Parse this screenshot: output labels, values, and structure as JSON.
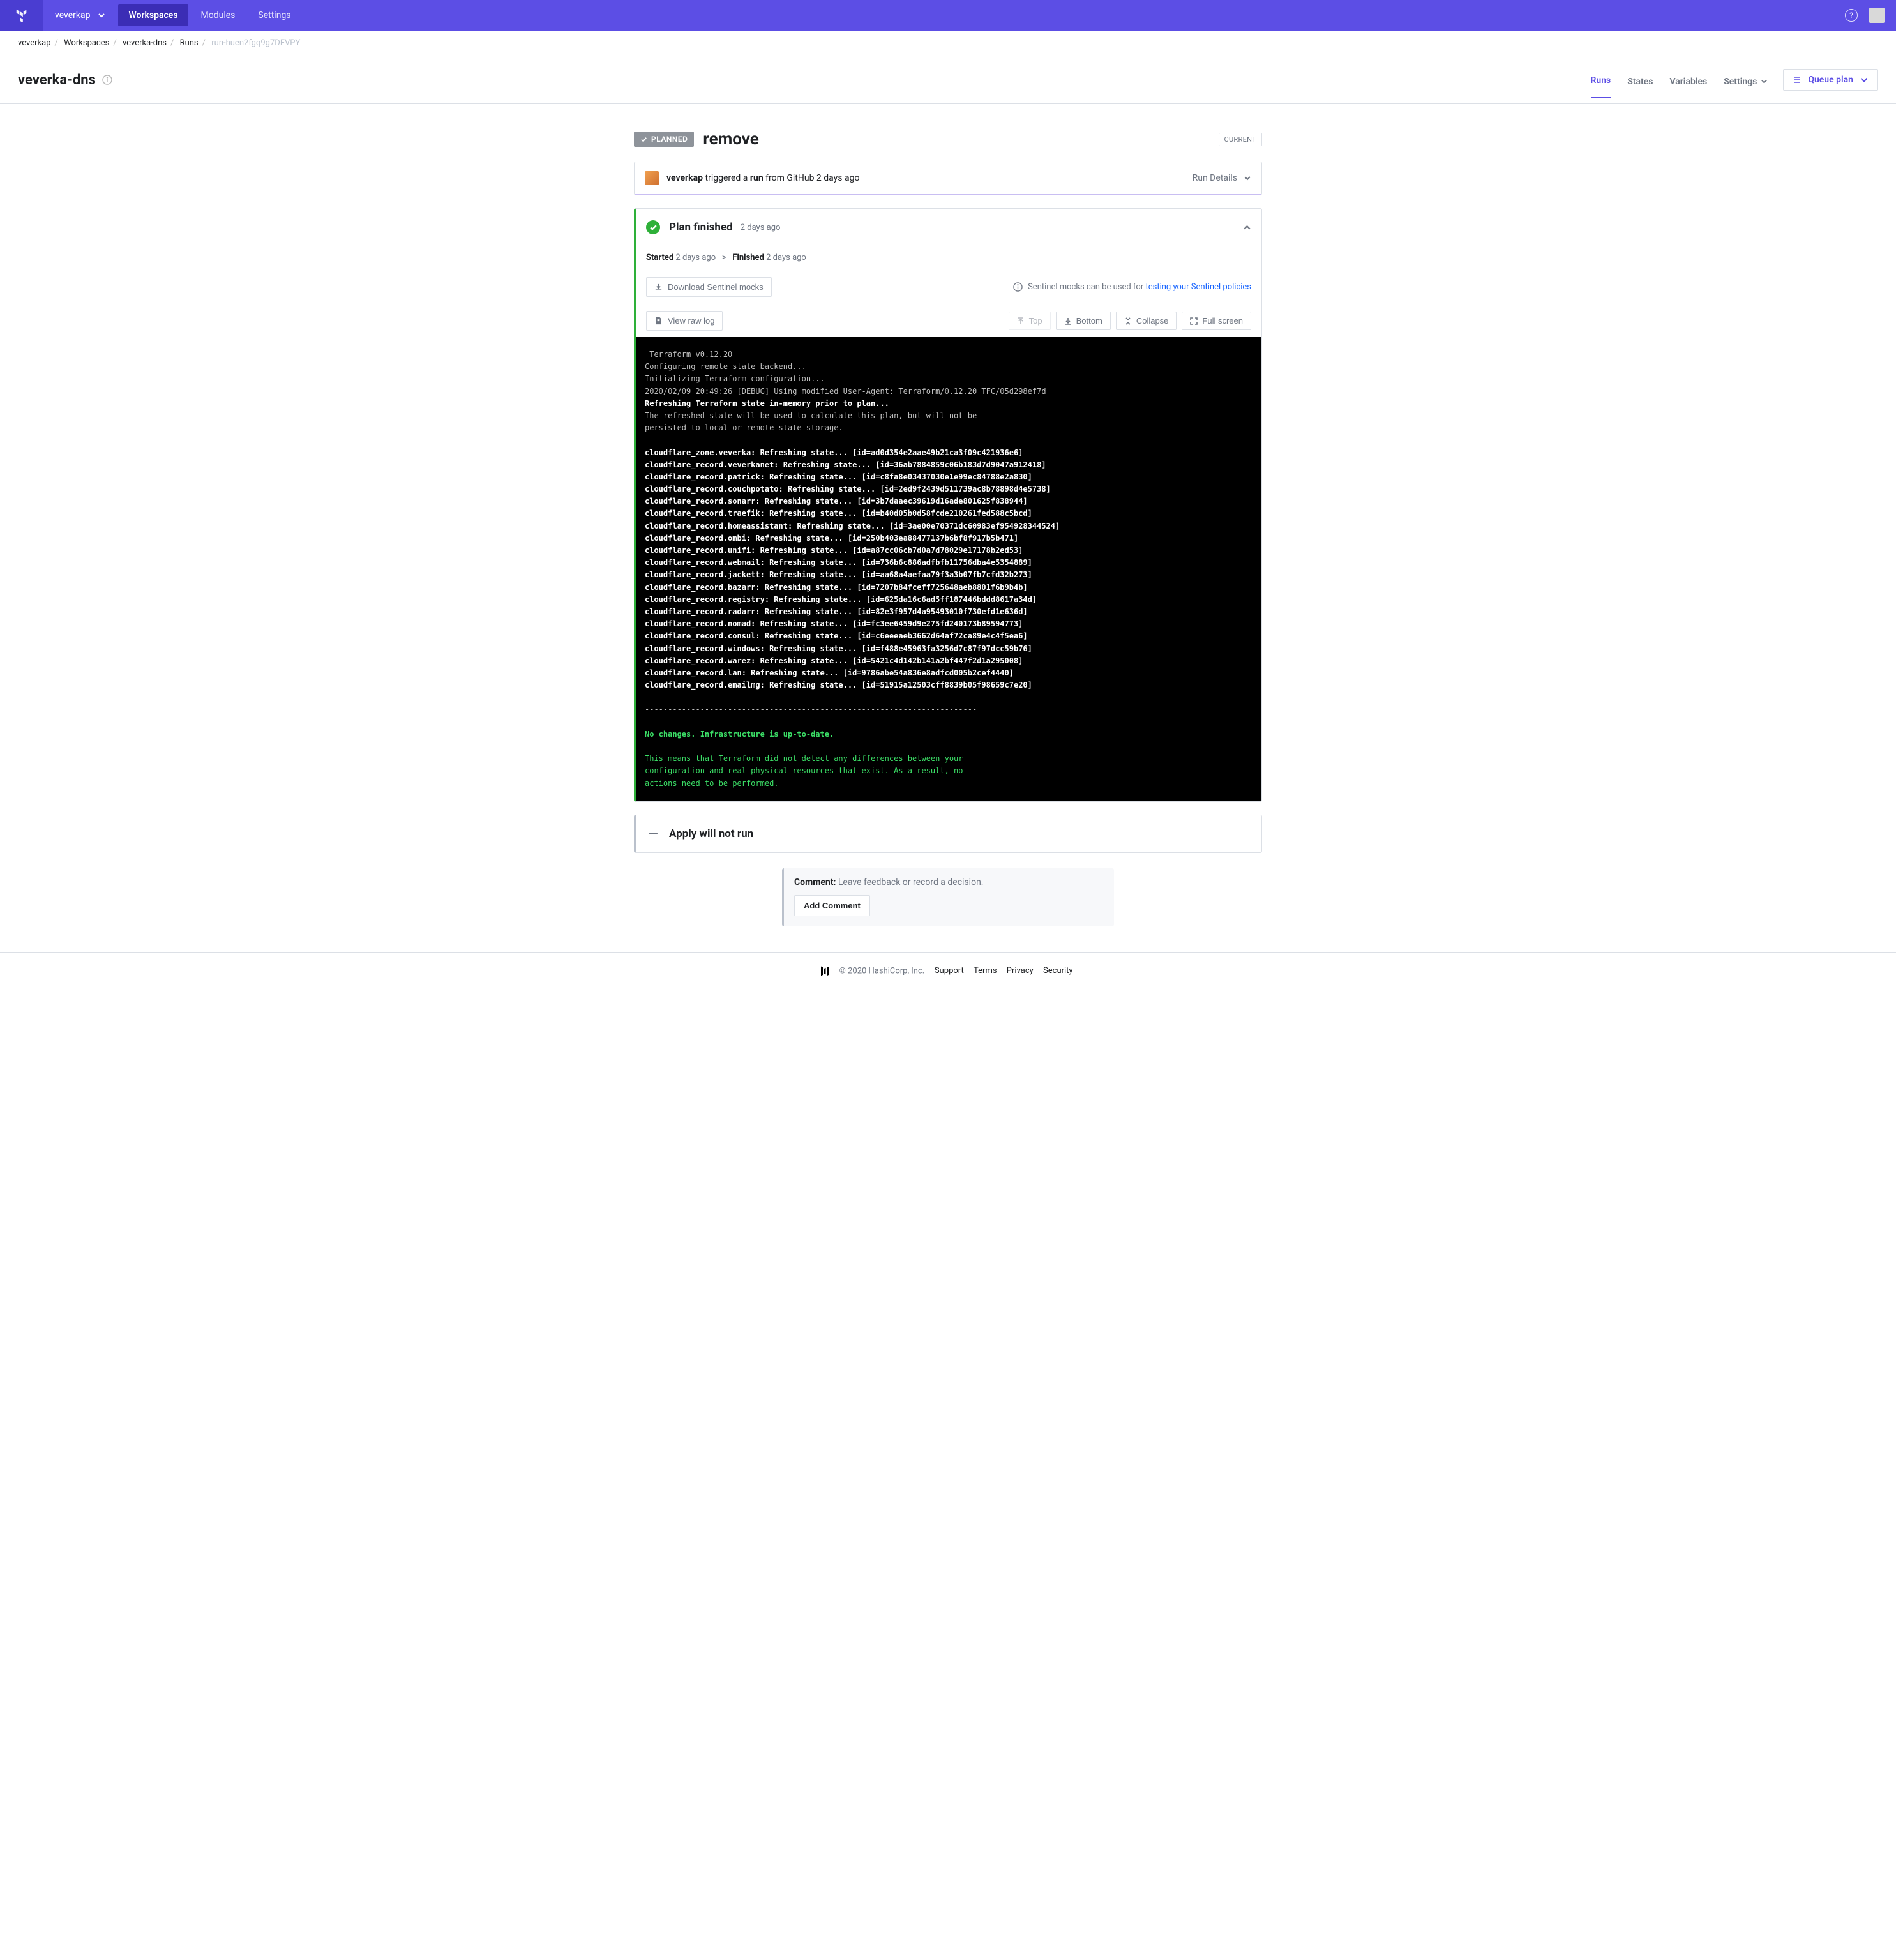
{
  "topbar": {
    "org": "veverkap",
    "tabs": [
      "Workspaces",
      "Modules",
      "Settings"
    ],
    "activeTab": 0
  },
  "breadcrumbs": {
    "items": [
      "veverkap",
      "Workspaces",
      "veverka-dns",
      "Runs"
    ],
    "current": "run-huen2fgq9g7DFVPY"
  },
  "workspace": {
    "title": "veverka-dns",
    "tabs": [
      "Runs",
      "States",
      "Variables"
    ],
    "settingsLabel": "Settings",
    "activeTab": 0,
    "queueLabel": "Queue plan"
  },
  "run": {
    "statusBadge": "PLANNED",
    "title": "remove",
    "currentLabel": "CURRENT",
    "triggeredBy": "veverkap",
    "triggeredText1": " triggered a ",
    "triggeredBold": "run",
    "triggeredText2": " from GitHub 2 days ago",
    "runDetailsLabel": "Run Details"
  },
  "plan": {
    "title": "Plan finished",
    "time": "2 days ago",
    "startedLabel": "Started",
    "startedVal": "2 days ago",
    "finishedLabel": "Finished",
    "finishedVal": "2 days ago",
    "downloadLabel": "Download Sentinel mocks",
    "mocksInfo": "Sentinel mocks can be used for ",
    "mocksLink": "testing your Sentinel policies",
    "rawLogLabel": "View raw log",
    "topLabel": "Top",
    "bottomLabel": "Bottom",
    "collapseLabel": "Collapse",
    "fullscreenLabel": "Full screen"
  },
  "log": {
    "l1": " Terraform v0.12.20",
    "l2": "Configuring remote state backend...",
    "l3": "Initializing Terraform configuration...",
    "l4": "2020/02/09 20:49:26 [DEBUG] Using modified User-Agent: Terraform/0.12.20 TFC/05d298ef7d",
    "l5": "Refreshing Terraform state in-memory prior to plan...",
    "l6": "The refreshed state will be used to calculate this plan, but will not be",
    "l7": "persisted to local or remote state storage.",
    "r1": "cloudflare_zone.veverka: Refreshing state... [id=ad0d354e2aae49b21ca3f09c421936e6]",
    "r2": "cloudflare_record.veverkanet: Refreshing state... [id=36ab7884859c06b183d7d9047a912418]",
    "r3": "cloudflare_record.patrick: Refreshing state... [id=c8fa8e03437030e1e99ec84788e2a830]",
    "r4": "cloudflare_record.couchpotato: Refreshing state... [id=2ed9f2439d511739ac8b78898d4e5738]",
    "r5": "cloudflare_record.sonarr: Refreshing state... [id=3b7daaec39619d16ade801625f838944]",
    "r6": "cloudflare_record.traefik: Refreshing state... [id=b40d05b0d58fcde210261fed588c5bcd]",
    "r7": "cloudflare_record.homeassistant: Refreshing state... [id=3ae00e70371dc60983ef954928344524]",
    "r8": "cloudflare_record.ombi: Refreshing state... [id=250b403ea88477137b6bf8f917b5b471]",
    "r9": "cloudflare_record.unifi: Refreshing state... [id=a87cc06cb7d0a7d78029e17178b2ed53]",
    "r10": "cloudflare_record.webmail: Refreshing state... [id=736b6c886adfbfb11756dba4e5354889]",
    "r11": "cloudflare_record.jackett: Refreshing state... [id=aa68a4aefaa79f3a3b07fb7cfd32b273]",
    "r12": "cloudflare_record.bazarr: Refreshing state... [id=7207b84fceff725648aeb8801f6b9b4b]",
    "r13": "cloudflare_record.registry: Refreshing state... [id=625da16c6ad5ff187446bddd8617a34d]",
    "r14": "cloudflare_record.radarr: Refreshing state... [id=82e3f957d4a95493010f730efd1e636d]",
    "r15": "cloudflare_record.nomad: Refreshing state... [id=fc3ee6459d9e275fd240173b89594773]",
    "r16": "cloudflare_record.consul: Refreshing state... [id=c6eeeaeb3662d64af72ca89e4c4f5ea6]",
    "r17": "cloudflare_record.windows: Refreshing state... [id=f488e45963fa3256d7c87f97dcc59b76]",
    "r18": "cloudflare_record.warez: Refreshing state... [id=5421c4d142b141a2bf447f2d1a295008]",
    "r19": "cloudflare_record.lan: Refreshing state... [id=9786abe54a836e8adfcd005b2cef4440]",
    "r20": "cloudflare_record.emailmg: Refreshing state... [id=51915a12503cff8839b05f98659c7e20]",
    "divider": "------------------------------------------------------------------------",
    "noChanges": "No changes. Infrastructure is up-to-date.",
    "exp1": "This means that Terraform did not detect any differences between your",
    "exp2": "configuration and real physical resources that exist. As a result, no",
    "exp3": "actions need to be performed."
  },
  "apply": {
    "title": "Apply will not run"
  },
  "comment": {
    "label": "Comment:",
    "placeholder": "Leave feedback or record a decision.",
    "button": "Add Comment"
  },
  "footer": {
    "copyright": "© 2020 HashiCorp, Inc.",
    "links": [
      "Support",
      "Terms",
      "Privacy",
      "Security"
    ]
  }
}
